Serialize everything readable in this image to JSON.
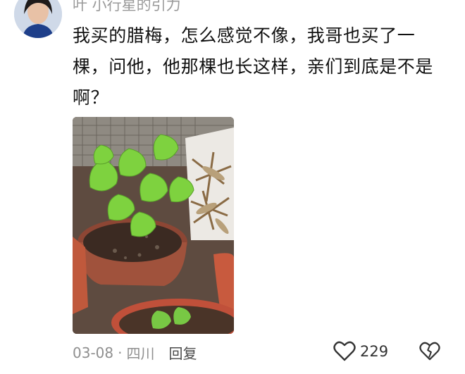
{
  "comment": {
    "username": "叶  小行星的引力",
    "text": "我买的腊梅，怎么感觉不像，我哥也买了一棵，问他，他那棵也长这样，亲们到底是不是啊？",
    "date": "03-08",
    "separator": "·",
    "location": "四川",
    "reply_label": "回复",
    "like_count": "229"
  },
  "icons": {
    "like": "heart-outline-icon",
    "dislike": "broken-heart-icon"
  },
  "colors": {
    "text_primary": "#111111",
    "text_secondary": "#8f8f8f",
    "username": "#9a9a9a"
  }
}
